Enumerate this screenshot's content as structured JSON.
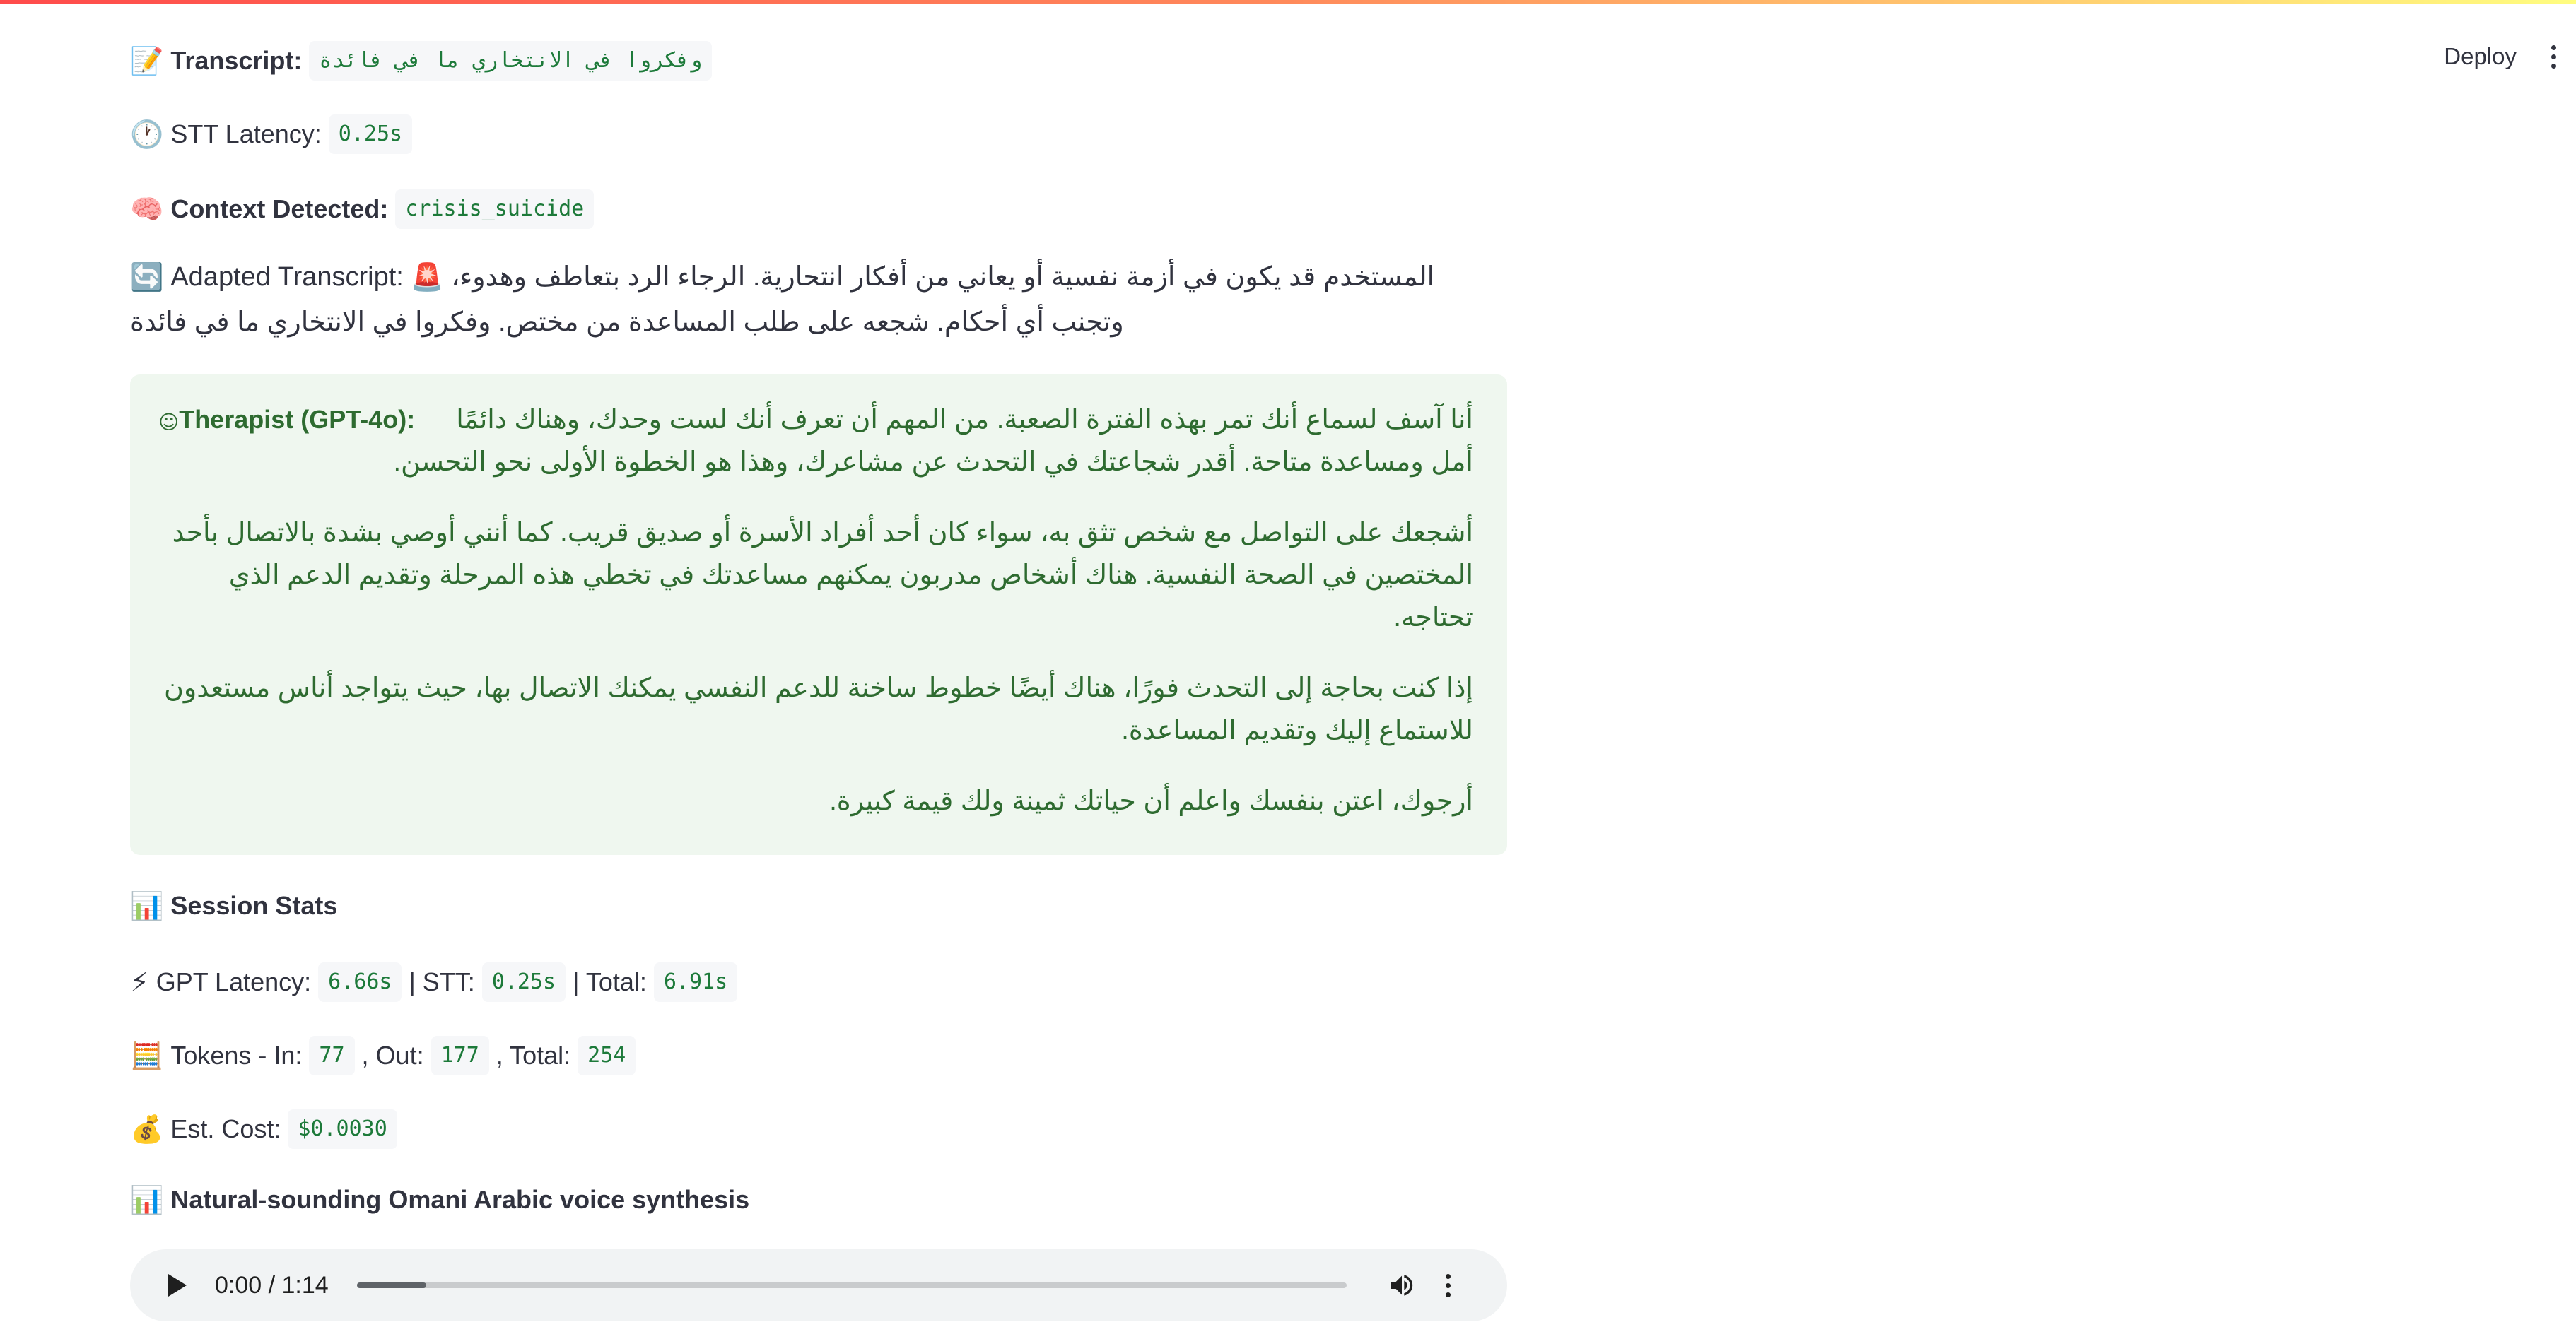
{
  "header": {
    "deploy_label": "Deploy"
  },
  "transcript": {
    "label": "Transcript:",
    "value": "وفكروا في الانتخاري ما في فائدة",
    "icon": "memo-icon"
  },
  "stt_latency": {
    "label": "STT Latency:",
    "value": "0.25s",
    "icon": "stopwatch-icon"
  },
  "context": {
    "label": "Context Detected:",
    "value": "crisis_suicide",
    "icon": "brain-icon"
  },
  "adapted": {
    "label": "Adapted Transcript:",
    "line1": "المستخدم قد يكون في أزمة نفسية أو يعاني من أفكار انتحارية. الرجاء الرد بتعاطف وهدوء،",
    "line2": "وتجنب أي أحكام. شجعه على طلب المساعدة من مختص. وفكروا في الانتخاري ما في فائدة",
    "icon": "refresh-icon",
    "alert_icon": "siren-icon"
  },
  "therapist": {
    "label": "Therapist (GPT-4o):",
    "paragraphs": [
      "أنا آسف لسماع أنك تمر بهذه الفترة الصعبة. من المهم أن تعرف أنك لست وحدك، وهناك دائمًا أمل ومساعدة متاحة. أقدر شجاعتك في التحدث عن مشاعرك، وهذا هو الخطوة الأولى نحو التحسن.",
      "أشجعك على التواصل مع شخص تثق به، سواء كان أحد أفراد الأسرة أو صديق قريب. كما أنني أوصي بشدة بالاتصال بأحد المختصين في الصحة النفسية. هناك أشخاص مدربون يمكنهم مساعدتك في تخطي هذه المرحلة وتقديم الدعم الذي تحتاجه.",
      "إذا كنت بحاجة إلى التحدث فورًا، هناك أيضًا خطوط ساخنة للدعم النفسي يمكنك الاتصال بها، حيث يتواجد أناس مستعدون للاستماع إليك وتقديم المساعدة.",
      "أرجوك، اعتن بنفسك واعلم أن حياتك ثمينة ولك قيمة كبيرة."
    ]
  },
  "session_stats": {
    "title": "Session Stats",
    "icon": "chart-icon"
  },
  "latency": {
    "gpt_label": "GPT Latency:",
    "gpt_value": "6.66s",
    "stt_label": "| STT:",
    "stt_value": "0.25s",
    "total_label": "| Total:",
    "total_value": "6.91s",
    "icon": "lightning-icon"
  },
  "tokens": {
    "in_label": "Tokens - In:",
    "in_value": "77",
    "out_label": ", Out:",
    "out_value": "177",
    "total_label": ", Total:",
    "total_value": "254",
    "icon": "abacus-icon"
  },
  "cost": {
    "label": "Est. Cost:",
    "value": "$0.0030",
    "icon": "money-bag-icon"
  },
  "voice": {
    "title": "Natural-sounding Omani Arabic voice synthesis",
    "icon": "chart-icon"
  },
  "audio": {
    "time": "0:00 / 1:14",
    "progress_fraction": 0.07
  }
}
